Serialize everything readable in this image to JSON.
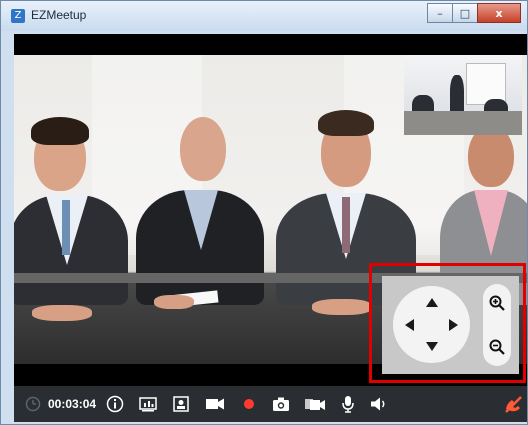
{
  "window": {
    "title": "EZMeetup",
    "controls": {
      "minimize": "–",
      "maximize": "□",
      "close": "x"
    }
  },
  "toolbar": {
    "elapsed_time": "00:03:04",
    "icons": [
      "clock-icon",
      "info-icon",
      "stats-icon",
      "contact-icon",
      "camera-video-icon",
      "record-icon",
      "snapshot-icon",
      "switch-camera-icon",
      "microphone-icon",
      "speaker-icon",
      "hangup-icon"
    ]
  },
  "ptz": {
    "controls": [
      "pan-up",
      "pan-down",
      "pan-left",
      "pan-right",
      "zoom-in",
      "zoom-out"
    ]
  },
  "colors": {
    "toolbar_bg": "#2a2e33",
    "highlight_box": "#e00000",
    "record": "#ff3b30",
    "hangup": "#ff5a36"
  }
}
